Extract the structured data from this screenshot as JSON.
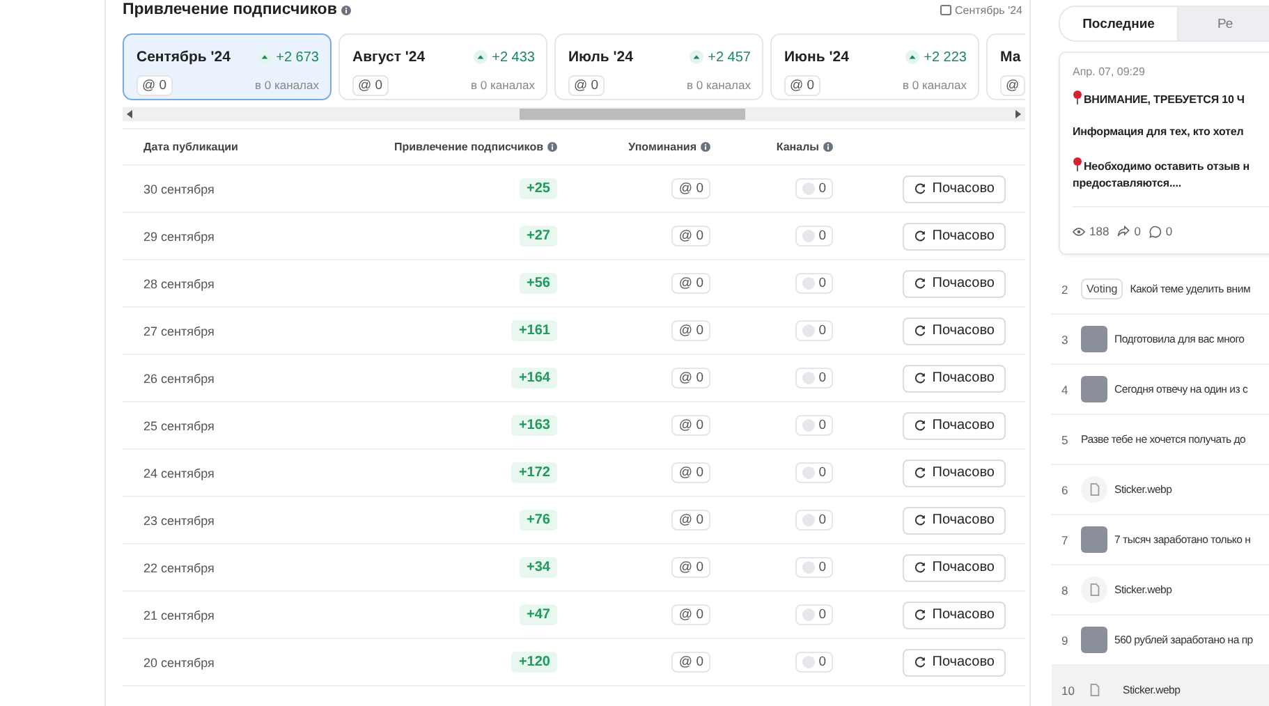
{
  "header": {
    "title": "Привлечение подписчиков",
    "period": "Сентябрь '24"
  },
  "months": [
    {
      "name": "Сентябрь '24",
      "growth": "+2 673",
      "mentions": "@ 0",
      "channels": "в 0 каналах",
      "selected": true
    },
    {
      "name": "Август '24",
      "growth": "+2 433",
      "mentions": "@ 0",
      "channels": "в 0 каналах",
      "selected": false
    },
    {
      "name": "Июль '24",
      "growth": "+2 457",
      "mentions": "@ 0",
      "channels": "в 0 каналах",
      "selected": false
    },
    {
      "name": "Июнь '24",
      "growth": "+2 223",
      "mentions": "@ 0",
      "channels": "в 0 каналах",
      "selected": false
    },
    {
      "name": "Ма",
      "mentions": "@",
      "selected": false
    }
  ],
  "table": {
    "columns": [
      "Дата публикации",
      "Привлечение подписчиков",
      "Упоминания",
      "Каналы"
    ],
    "rows": [
      {
        "date": "30 сентября",
        "growth": "+25",
        "mentions": "@ 0",
        "channels": "0",
        "action": "Почасово"
      },
      {
        "date": "29 сентября",
        "growth": "+27",
        "mentions": "@ 0",
        "channels": "0",
        "action": "Почасово"
      },
      {
        "date": "28 сентября",
        "growth": "+56",
        "mentions": "@ 0",
        "channels": "0",
        "action": "Почасово"
      },
      {
        "date": "27 сентября",
        "growth": "+161",
        "mentions": "@ 0",
        "channels": "0",
        "action": "Почасово"
      },
      {
        "date": "26 сентября",
        "growth": "+164",
        "mentions": "@ 0",
        "channels": "0",
        "action": "Почасово"
      },
      {
        "date": "25 сентября",
        "growth": "+163",
        "mentions": "@ 0",
        "channels": "0",
        "action": "Почасово"
      },
      {
        "date": "24 сентября",
        "growth": "+172",
        "mentions": "@ 0",
        "channels": "0",
        "action": "Почасово"
      },
      {
        "date": "23 сентября",
        "growth": "+76",
        "mentions": "@ 0",
        "channels": "0",
        "action": "Почасово"
      },
      {
        "date": "22 сентября",
        "growth": "+34",
        "mentions": "@ 0",
        "channels": "0",
        "action": "Почасово"
      },
      {
        "date": "21 сентября",
        "growth": "+47",
        "mentions": "@ 0",
        "channels": "0",
        "action": "Почасово"
      },
      {
        "date": "20 сентября",
        "growth": "+120",
        "mentions": "@ 0",
        "channels": "0",
        "action": "Почасово"
      }
    ]
  },
  "feed": {
    "tabs": [
      {
        "label": "Последние",
        "selected": true
      },
      {
        "label": "Ре",
        "selected": false
      }
    ],
    "post": {
      "time": "Апр. 07, 09:29",
      "lines": [
        {
          "text": "ВНИМАНИЕ, ТРЕБУЕТСЯ 10 Ч",
          "pin": true
        },
        {
          "text": "Информация для тех, кто хотел",
          "pin": false
        },
        {
          "text": "Необходимо оставить отзыв н",
          "pin": true
        },
        {
          "text": "предоставляются....",
          "pin": false
        }
      ],
      "views": "188",
      "reposts": "0",
      "comments": "0"
    },
    "items": [
      {
        "index": "2",
        "kind": "voting",
        "tag": "Voting",
        "text": "Какой теме уделить вним",
        "selected": false
      },
      {
        "index": "3",
        "kind": "photo",
        "text": "Подготовила для вас много",
        "selected": false
      },
      {
        "index": "4",
        "kind": "photo",
        "text": "Сегодня отвечу на один из с",
        "selected": false
      },
      {
        "index": "5",
        "kind": "text",
        "text": "Разве тебе не хочется получать до",
        "selected": false
      },
      {
        "index": "6",
        "kind": "file",
        "text": "Sticker.webp",
        "selected": false
      },
      {
        "index": "7",
        "kind": "photo",
        "text": "7 тысяч заработано только н",
        "selected": false
      },
      {
        "index": "8",
        "kind": "file",
        "text": "Sticker.webp",
        "selected": false
      },
      {
        "index": "9",
        "kind": "photo",
        "text": "560 рублей заработано на пр",
        "selected": false
      },
      {
        "index": "10",
        "kind": "file-plain",
        "text": "Sticker.webp",
        "selected": true
      }
    ]
  }
}
